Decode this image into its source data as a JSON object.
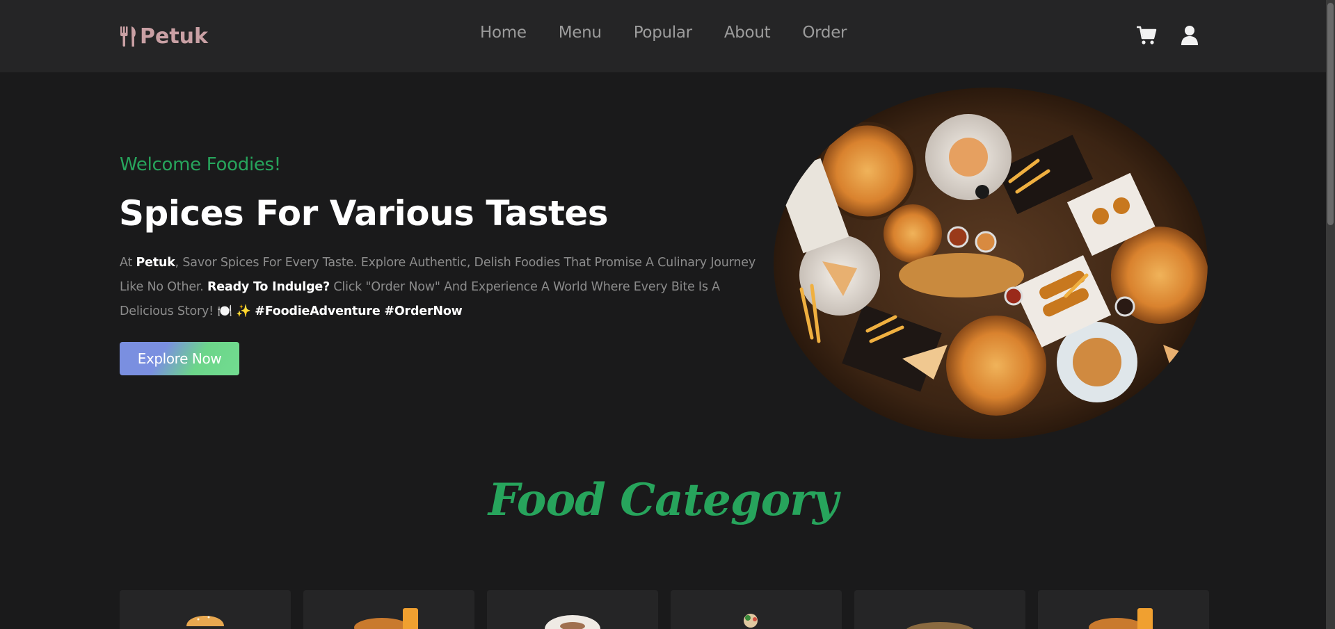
{
  "header": {
    "brand": "Petuk",
    "nav": [
      {
        "label": "Home"
      },
      {
        "label": "Menu"
      },
      {
        "label": "Popular"
      },
      {
        "label": "About"
      },
      {
        "label": "Order"
      }
    ],
    "icons": [
      "cart-icon",
      "user-icon"
    ]
  },
  "hero": {
    "welcome": "Welcome Foodies!",
    "title": "Spices For Various Tastes",
    "desc": {
      "p1": "At ",
      "brand": "Petuk",
      "p2": ", Savor Spices For Every Taste. Explore Authentic, Delish Foodies That Promise A Culinary Journey Like No Other. ",
      "strong": "Ready To Indulge?",
      "p3": " Click \"Order Now\" And Experience A World Where Every Bite Is A Delicious Story! 🍽️ ✨ ",
      "tags": "#FoodieAdventure #OrderNow"
    },
    "button": "Explore Now"
  },
  "category": {
    "title": "Food Category",
    "cards": [
      {
        "icon": "burger-icon"
      },
      {
        "icon": "meal-drink-icon"
      },
      {
        "icon": "plate-icon"
      },
      {
        "icon": "dessert-icon"
      },
      {
        "icon": "bread-icon"
      },
      {
        "icon": "meal-drink-icon"
      }
    ]
  },
  "colors": {
    "accent_green": "#27a45c",
    "header_bg": "#252526",
    "page_bg": "#1a1a1b",
    "logo": "#c9a0a4"
  }
}
